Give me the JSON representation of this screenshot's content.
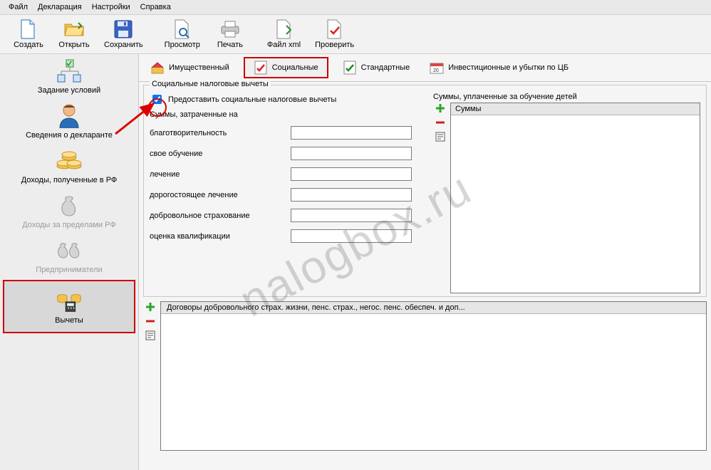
{
  "menu": {
    "file": "Файл",
    "decl": "Декларация",
    "settings": "Настройки",
    "help": "Справка"
  },
  "toolbar": {
    "create": "Создать",
    "open": "Открыть",
    "save": "Сохранить",
    "preview": "Просмотр",
    "print": "Печать",
    "xml": "Файл xml",
    "check": "Проверить"
  },
  "sidebar": {
    "conditions": "Задание условий",
    "declarant": "Сведения о декларанте",
    "income_rf": "Доходы, полученные в РФ",
    "income_abroad": "Доходы за пределами РФ",
    "entrepreneurs": "Предприниматели",
    "deductions": "Вычеты"
  },
  "tabs": {
    "property": "Имущественный",
    "social": "Социальные",
    "standard": "Стандартные",
    "invest": "Инвестиционные и убытки по ЦБ"
  },
  "group": {
    "title": "Социальные налоговые вычеты",
    "provide": "Предоставить социальные налоговые вычеты",
    "spent_on": "Суммы, затраченные на",
    "charity": "благотворительность",
    "own_edu": "свое обучение",
    "treatment": "лечение",
    "exp_treatment": "дорогостоящее лечение",
    "vol_insurance": "добровольное страхование",
    "qualification": "оценка квалификации",
    "children_edu_title": "Суммы, уплаченные за обучение детей",
    "sums_col": "Суммы"
  },
  "lower": {
    "title": "Договоры добровольного страх. жизни, пенс. страх., негос. пенс. обеспеч. и доп..."
  },
  "values": {
    "charity": "",
    "own_edu": "",
    "treatment": "",
    "exp_treatment": "",
    "vol_insurance": "",
    "qualification": ""
  },
  "watermark": "nalogbox.ru",
  "colors": {
    "highlight": "#cc0000",
    "plus": "#2aa52a",
    "minus": "#cc2222"
  }
}
